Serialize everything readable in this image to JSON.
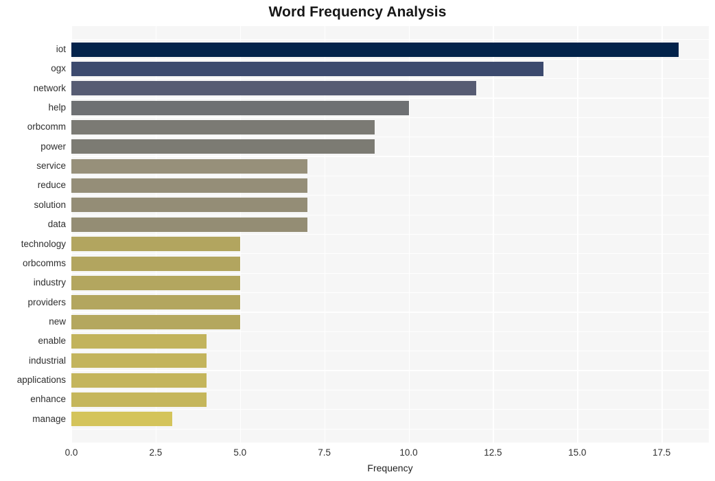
{
  "chart_data": {
    "type": "bar",
    "orientation": "horizontal",
    "title": "Word Frequency Analysis",
    "xlabel": "Frequency",
    "ylabel": "",
    "xlim": [
      0,
      18.9
    ],
    "xticks": [
      0.0,
      2.5,
      5.0,
      7.5,
      10.0,
      12.5,
      15.0,
      17.5
    ],
    "xtick_labels": [
      "0.0",
      "2.5",
      "5.0",
      "7.5",
      "10.0",
      "12.5",
      "15.0",
      "17.5"
    ],
    "grid": true,
    "legend": "none",
    "categories": [
      "iot",
      "ogx",
      "network",
      "help",
      "orbcomm",
      "power",
      "service",
      "reduce",
      "solution",
      "data",
      "technology",
      "orbcomms",
      "industry",
      "providers",
      "new",
      "enable",
      "industrial",
      "applications",
      "enhance",
      "manage"
    ],
    "values": [
      18,
      14,
      12,
      10,
      9,
      9,
      7,
      7,
      7,
      7,
      5,
      5,
      5,
      5,
      5,
      4,
      4,
      4,
      4,
      3
    ],
    "bar_colors": [
      "#03234b",
      "#3c4a6e",
      "#575c73",
      "#6e7073",
      "#7b7a74",
      "#7c7b73",
      "#97907a",
      "#958e78",
      "#948d76",
      "#948d74",
      "#b2a55f",
      "#b2a55f",
      "#b3a65f",
      "#b3a65f",
      "#b4a75e",
      "#c2b35c",
      "#c3b45c",
      "#c4b55c",
      "#c5b65b",
      "#d4c45b"
    ],
    "plot_background": "#f6f6f6",
    "grid_color": "#ffffff",
    "figure_background": "#ffffff"
  },
  "axis_meta": {
    "title_label": "Word Frequency Analysis",
    "x_axis_label": "Frequency"
  }
}
